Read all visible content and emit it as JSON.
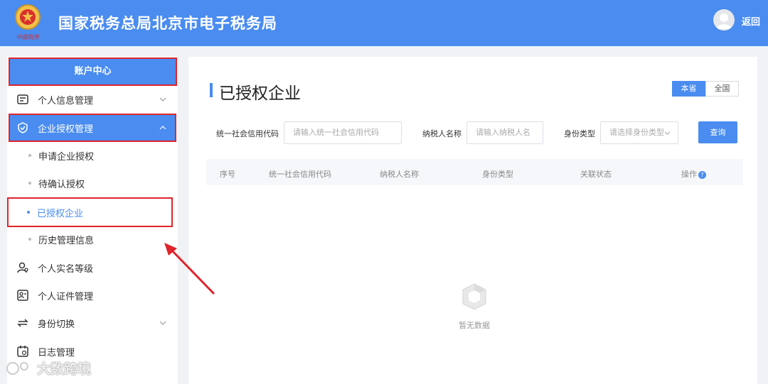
{
  "header": {
    "title": "国家税务总局北京市电子税务局",
    "back_label": "返回",
    "emblem_text": "中国税务"
  },
  "sidebar": {
    "account_center": "账户中心",
    "items": [
      {
        "label": "个人信息管理",
        "icon": "profile-card-icon"
      },
      {
        "label": "企业授权管理",
        "icon": "shield-check-icon"
      },
      {
        "label": "个人实名等级",
        "icon": "person-badge-icon"
      },
      {
        "label": "个人证件管理",
        "icon": "id-card-icon"
      },
      {
        "label": "身份切换",
        "icon": "switch-icon"
      },
      {
        "label": "日志管理",
        "icon": "log-icon"
      }
    ],
    "sub_items": [
      {
        "label": "申请企业授权"
      },
      {
        "label": "待确认授权"
      },
      {
        "label": "已授权企业"
      },
      {
        "label": "历史管理信息"
      }
    ]
  },
  "main": {
    "title": "已授权企业",
    "scope": {
      "province": "本省",
      "national": "全国"
    },
    "filters": {
      "credit_code_label": "统一社会信用代码",
      "credit_code_placeholder": "请输入统一社会信用代码",
      "taxpayer_label": "纳税人名称",
      "taxpayer_placeholder": "请输入纳税人名",
      "identity_label": "身份类型",
      "identity_placeholder": "请选择身份类型"
    },
    "search_label": "查询",
    "table": {
      "columns": [
        "序号",
        "统一社会信用代码",
        "纳税人名称",
        "身份类型",
        "关联状态",
        "操作"
      ]
    },
    "empty_text": "暂无数据"
  },
  "watermark": "大数跨境",
  "colors": {
    "primary": "#4a8cf0",
    "highlight_box": "#e0242b"
  }
}
